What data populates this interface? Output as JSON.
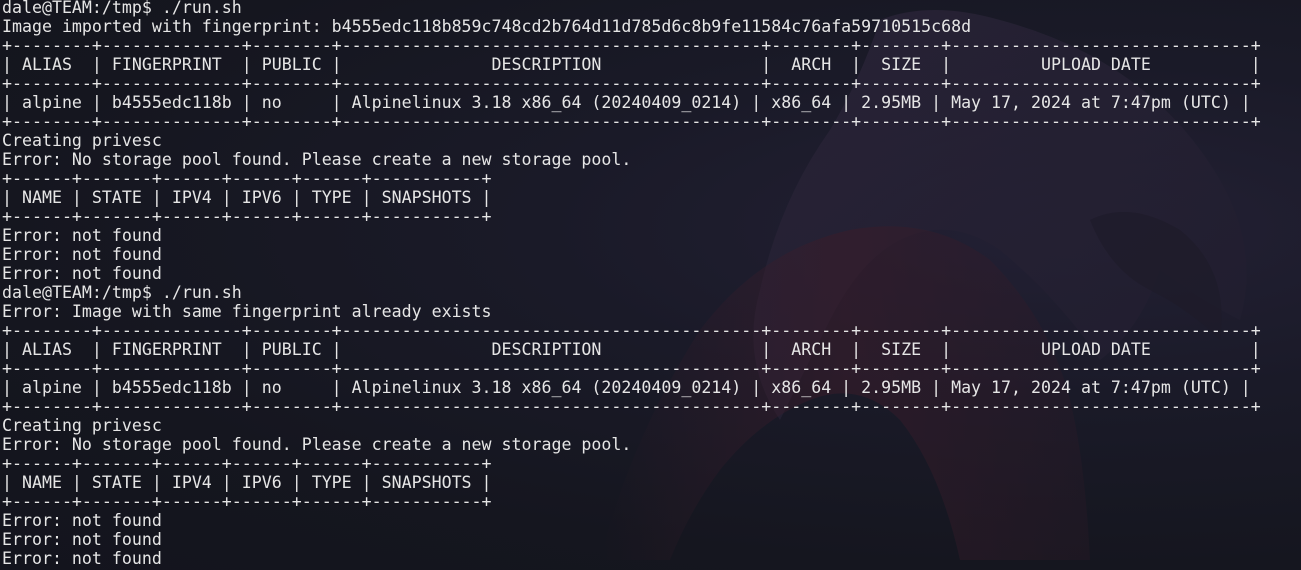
{
  "terminal": {
    "background_color": "#14151f",
    "text_color": "#e6e6e6",
    "lines": [
      "dale@TEAM:/tmp$ ./run.sh",
      "Image imported with fingerprint: b4555edc118b859c748cd2b764d11d785d6c8b9fe11584c76afa59710515c68d",
      "+--------+--------------+--------+------------------------------------------+--------+--------+------------------------------+",
      "| ALIAS  | FINGERPRINT  | PUBLIC |               DESCRIPTION                |  ARCH  |  SIZE  |         UPLOAD DATE          |",
      "+--------+--------------+--------+------------------------------------------+--------+--------+------------------------------+",
      "| alpine | b4555edc118b | no     | Alpinelinux 3.18 x86_64 (20240409_0214) | x86_64 | 2.95MB | May 17, 2024 at 7:47pm (UTC) |",
      "+--------+--------------+--------+------------------------------------------+--------+--------+------------------------------+",
      "Creating privesc",
      "Error: No storage pool found. Please create a new storage pool.",
      "+------+-------+------+------+------+-----------+",
      "| NAME | STATE | IPV4 | IPV6 | TYPE | SNAPSHOTS |",
      "+------+-------+------+------+------+-----------+",
      "Error: not found",
      "Error: not found",
      "Error: not found",
      "dale@TEAM:/tmp$ ./run.sh",
      "Error: Image with same fingerprint already exists",
      "+--------+--------------+--------+------------------------------------------+--------+--------+------------------------------+",
      "| ALIAS  | FINGERPRINT  | PUBLIC |               DESCRIPTION                |  ARCH  |  SIZE  |         UPLOAD DATE          |",
      "+--------+--------------+--------+------------------------------------------+--------+--------+------------------------------+",
      "| alpine | b4555edc118b | no     | Alpinelinux 3.18 x86_64 (20240409_0214) | x86_64 | 2.95MB | May 17, 2024 at 7:47pm (UTC) |",
      "+--------+--------------+--------+------------------------------------------+--------+--------+------------------------------+",
      "Creating privesc",
      "Error: No storage pool found. Please create a new storage pool.",
      "+------+-------+------+------+------+-----------+",
      "| NAME | STATE | IPV4 | IPV6 | TYPE | SNAPSHOTS |",
      "+------+-------+------+------+------+-----------+",
      "Error: not found",
      "Error: not found",
      "Error: not found"
    ]
  }
}
